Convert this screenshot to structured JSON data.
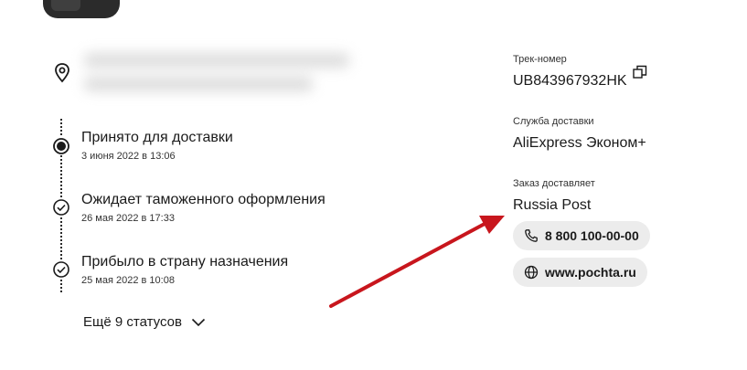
{
  "timeline": {
    "steps": [
      {
        "title": "Принято для доставки",
        "date": "3 июня 2022 в 13:06",
        "state": "current"
      },
      {
        "title": "Ожидает таможенного оформления",
        "date": "26 мая 2022 в 17:33",
        "state": "done"
      },
      {
        "title": "Прибыло в страну назначения",
        "date": "25 мая 2022 в 10:08",
        "state": "done"
      }
    ],
    "more_label": "Ещё 9 статусов"
  },
  "info": {
    "track_label": "Трек-номер",
    "track_value": "UB843967932HK",
    "service_label": "Служба доставки",
    "service_value": "AliExpress Эконом+",
    "carrier_label": "Заказ доставляет",
    "carrier_value": "Russia Post",
    "phone": "8 800 100-00-00",
    "website": "www.pochta.ru"
  },
  "colors": {
    "arrow": "#c8161d",
    "pill_bg": "#ececec"
  }
}
